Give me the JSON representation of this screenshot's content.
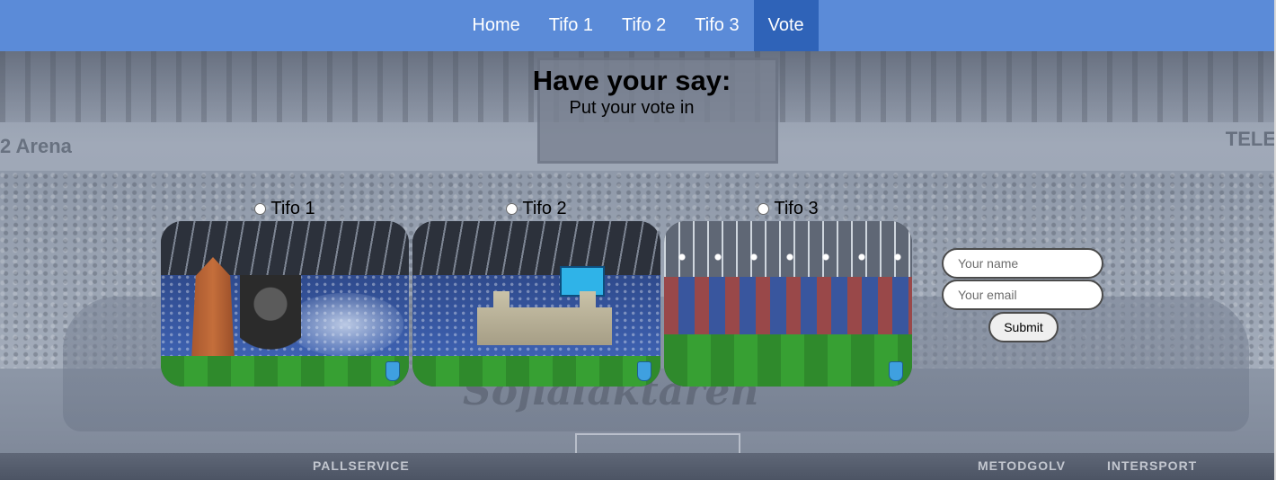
{
  "nav": {
    "items": [
      {
        "label": "Home"
      },
      {
        "label": "Tifo 1"
      },
      {
        "label": "Tifo 2"
      },
      {
        "label": "Tifo 3"
      },
      {
        "label": "Vote"
      }
    ],
    "active": "Vote",
    "bar_color": "#5b8bd8",
    "active_color": "#2f63b8"
  },
  "heading": {
    "title": "Have your say:",
    "subtitle": "Put your vote in"
  },
  "options": [
    {
      "label": "Tifo 1",
      "selected": false,
      "image_icon": "tifo-photo-tower-gorilla"
    },
    {
      "label": "Tifo 2",
      "selected": false,
      "image_icon": "tifo-photo-stadium-banner"
    },
    {
      "label": "Tifo 3",
      "selected": false,
      "image_icon": "tifo-photo-stadium-pitch"
    }
  ],
  "form": {
    "name_placeholder": "Your name",
    "email_placeholder": "Your email",
    "submit_label": "Submit"
  },
  "background": {
    "arena_text": "2 Arena",
    "right_text": "TELE",
    "script_text": "Sofialäktaren",
    "ads": [
      "PALLSERVICE",
      "METODGOLV",
      "INTERSPORT"
    ],
    "tint": "#9aa3b3"
  }
}
